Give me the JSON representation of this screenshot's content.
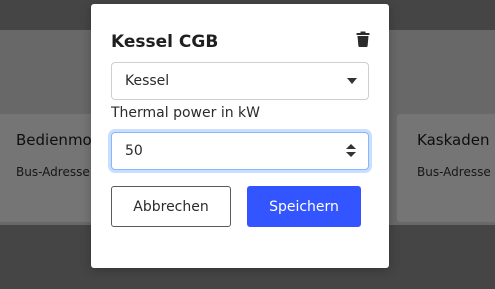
{
  "background": {
    "cards": [
      {
        "title": "Bedienmo",
        "subtitle": "Bus-Adresse"
      },
      {
        "title": "Kaskaden",
        "subtitle": "Bus-Adresse"
      }
    ]
  },
  "modal": {
    "title": "Kessel CGB",
    "delete_icon": "trash-icon",
    "type_select": {
      "value": "Kessel"
    },
    "power_field": {
      "label": "Thermal power in kW",
      "value": "50"
    },
    "buttons": {
      "cancel_label": "Abbrechen",
      "save_label": "Speichern"
    }
  },
  "colors": {
    "primary": "#3355ff",
    "focus_border": "#86b7fe"
  }
}
